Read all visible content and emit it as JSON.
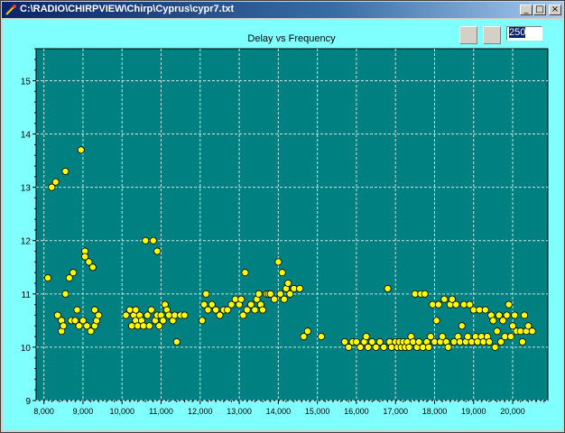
{
  "window": {
    "title": "C:\\RADIO\\CHIRPVIEW\\Chirp\\Cyprus\\cypr7.txt",
    "minimize_glyph": "_",
    "maximize_glyph": "□",
    "close_glyph": "×"
  },
  "toolbar": {
    "value_input": "250"
  },
  "colors": {
    "background": "#80ffff",
    "plot_area": "#008080",
    "grid": "#c0e8e8",
    "marker_fill": "#ffff00",
    "marker_edge": "#000000"
  },
  "chart_data": {
    "type": "scatter",
    "title": "Delay vs Frequency",
    "xlabel": "",
    "ylabel": "",
    "xlim": [
      7800,
      20900
    ],
    "ylim": [
      9,
      15.6
    ],
    "x_ticks": [
      8000,
      9000,
      10000,
      11000,
      12000,
      13000,
      14000,
      15000,
      16000,
      17000,
      18000,
      19000,
      20000
    ],
    "x_tick_labels": [
      "8,000",
      "9,000",
      "10,000",
      "11,000",
      "12,000",
      "13,000",
      "14,000",
      "15,000",
      "16,000",
      "17,000",
      "18,000",
      "19,000",
      "20,000"
    ],
    "y_ticks": [
      9,
      10,
      11,
      12,
      13,
      14,
      15
    ],
    "y_tick_labels": [
      "9",
      "10",
      "11",
      "12",
      "13",
      "14",
      "15"
    ],
    "grid": true,
    "legend": "none",
    "marker": "circle",
    "points": [
      [
        8100,
        11.3
      ],
      [
        8200,
        13.0
      ],
      [
        8300,
        13.1
      ],
      [
        8350,
        10.6
      ],
      [
        8450,
        10.5
      ],
      [
        8450,
        10.3
      ],
      [
        8500,
        10.4
      ],
      [
        8550,
        13.3
      ],
      [
        8550,
        11.0
      ],
      [
        8650,
        11.3
      ],
      [
        8700,
        10.5
      ],
      [
        8750,
        11.4
      ],
      [
        8800,
        10.5
      ],
      [
        8850,
        10.7
      ],
      [
        8900,
        10.4
      ],
      [
        8950,
        13.7
      ],
      [
        9000,
        10.5
      ],
      [
        9050,
        11.8
      ],
      [
        9050,
        11.7
      ],
      [
        9100,
        10.4
      ],
      [
        9150,
        11.6
      ],
      [
        9200,
        10.3
      ],
      [
        9250,
        11.5
      ],
      [
        9300,
        10.7
      ],
      [
        9300,
        10.4
      ],
      [
        9350,
        10.5
      ],
      [
        9400,
        10.6
      ],
      [
        10100,
        10.6
      ],
      [
        10200,
        10.7
      ],
      [
        10250,
        10.4
      ],
      [
        10300,
        10.6
      ],
      [
        10350,
        10.5
      ],
      [
        10350,
        10.7
      ],
      [
        10400,
        10.4
      ],
      [
        10450,
        10.6
      ],
      [
        10500,
        10.5
      ],
      [
        10550,
        10.4
      ],
      [
        10600,
        12.0
      ],
      [
        10650,
        10.6
      ],
      [
        10700,
        10.4
      ],
      [
        10750,
        10.7
      ],
      [
        10800,
        12.0
      ],
      [
        10850,
        10.5
      ],
      [
        10900,
        10.6
      ],
      [
        10900,
        11.8
      ],
      [
        10950,
        10.4
      ],
      [
        11000,
        10.6
      ],
      [
        11050,
        10.5
      ],
      [
        11100,
        10.8
      ],
      [
        11150,
        10.7
      ],
      [
        11200,
        10.6
      ],
      [
        11300,
        10.5
      ],
      [
        11350,
        10.6
      ],
      [
        11400,
        10.1
      ],
      [
        11500,
        10.6
      ],
      [
        11600,
        10.6
      ],
      [
        12050,
        10.5
      ],
      [
        12100,
        10.8
      ],
      [
        12150,
        11.0
      ],
      [
        12200,
        10.7
      ],
      [
        12300,
        10.8
      ],
      [
        12400,
        10.7
      ],
      [
        12500,
        10.6
      ],
      [
        12600,
        10.7
      ],
      [
        12700,
        10.7
      ],
      [
        12800,
        10.8
      ],
      [
        12900,
        10.9
      ],
      [
        13000,
        10.8
      ],
      [
        13050,
        10.9
      ],
      [
        13100,
        10.6
      ],
      [
        13150,
        11.4
      ],
      [
        13200,
        10.7
      ],
      [
        13300,
        10.8
      ],
      [
        13400,
        10.7
      ],
      [
        13450,
        10.9
      ],
      [
        13500,
        11.0
      ],
      [
        13550,
        10.8
      ],
      [
        13600,
        10.7
      ],
      [
        13700,
        11.0
      ],
      [
        13750,
        11.0
      ],
      [
        13800,
        11.0
      ],
      [
        13900,
        10.9
      ],
      [
        14000,
        11.6
      ],
      [
        14050,
        11.0
      ],
      [
        14100,
        11.4
      ],
      [
        14150,
        10.9
      ],
      [
        14200,
        11.1
      ],
      [
        14250,
        11.2
      ],
      [
        14300,
        11.0
      ],
      [
        14400,
        11.1
      ],
      [
        14550,
        11.1
      ],
      [
        14650,
        10.2
      ],
      [
        14750,
        10.3
      ],
      [
        15100,
        10.2
      ],
      [
        15700,
        10.1
      ],
      [
        15800,
        10.0
      ],
      [
        15900,
        10.1
      ],
      [
        16000,
        10.1
      ],
      [
        16100,
        10.0
      ],
      [
        16200,
        10.1
      ],
      [
        16250,
        10.2
      ],
      [
        16300,
        10.0
      ],
      [
        16400,
        10.1
      ],
      [
        16500,
        10.0
      ],
      [
        16600,
        10.1
      ],
      [
        16700,
        10.0
      ],
      [
        16800,
        11.1
      ],
      [
        16850,
        10.1
      ],
      [
        16900,
        10.0
      ],
      [
        17000,
        10.1
      ],
      [
        17050,
        10.0
      ],
      [
        17100,
        10.1
      ],
      [
        17150,
        10.0
      ],
      [
        17200,
        10.1
      ],
      [
        17250,
        10.0
      ],
      [
        17300,
        10.1
      ],
      [
        17350,
        10.0
      ],
      [
        17400,
        10.2
      ],
      [
        17450,
        10.1
      ],
      [
        17500,
        11.0
      ],
      [
        17550,
        10.0
      ],
      [
        17600,
        10.1
      ],
      [
        17650,
        11.0
      ],
      [
        17700,
        10.0
      ],
      [
        17750,
        11.0
      ],
      [
        17800,
        10.1
      ],
      [
        17850,
        10.0
      ],
      [
        17900,
        10.2
      ],
      [
        17950,
        10.8
      ],
      [
        18000,
        10.1
      ],
      [
        18050,
        10.5
      ],
      [
        18100,
        10.8
      ],
      [
        18150,
        10.1
      ],
      [
        18200,
        10.2
      ],
      [
        18250,
        10.9
      ],
      [
        18300,
        10.1
      ],
      [
        18350,
        10.0
      ],
      [
        18400,
        10.8
      ],
      [
        18450,
        10.9
      ],
      [
        18500,
        10.1
      ],
      [
        18550,
        10.8
      ],
      [
        18600,
        10.2
      ],
      [
        18650,
        10.1
      ],
      [
        18700,
        10.4
      ],
      [
        18750,
        10.8
      ],
      [
        18800,
        10.1
      ],
      [
        18850,
        10.2
      ],
      [
        18900,
        10.8
      ],
      [
        18950,
        10.1
      ],
      [
        19000,
        10.7
      ],
      [
        19050,
        10.2
      ],
      [
        19100,
        10.1
      ],
      [
        19150,
        10.7
      ],
      [
        19200,
        10.2
      ],
      [
        19250,
        10.1
      ],
      [
        19300,
        10.7
      ],
      [
        19350,
        10.2
      ],
      [
        19400,
        10.1
      ],
      [
        19450,
        10.6
      ],
      [
        19500,
        10.5
      ],
      [
        19550,
        10.0
      ],
      [
        19600,
        10.3
      ],
      [
        19650,
        10.6
      ],
      [
        19700,
        10.1
      ],
      [
        19750,
        10.5
      ],
      [
        19800,
        10.2
      ],
      [
        19850,
        10.6
      ],
      [
        19900,
        10.8
      ],
      [
        19950,
        10.2
      ],
      [
        20000,
        10.4
      ],
      [
        20050,
        10.6
      ],
      [
        20100,
        10.3
      ],
      [
        20200,
        10.3
      ],
      [
        20250,
        10.1
      ],
      [
        20300,
        10.6
      ],
      [
        20350,
        10.3
      ],
      [
        20400,
        10.4
      ],
      [
        20500,
        10.3
      ]
    ]
  }
}
